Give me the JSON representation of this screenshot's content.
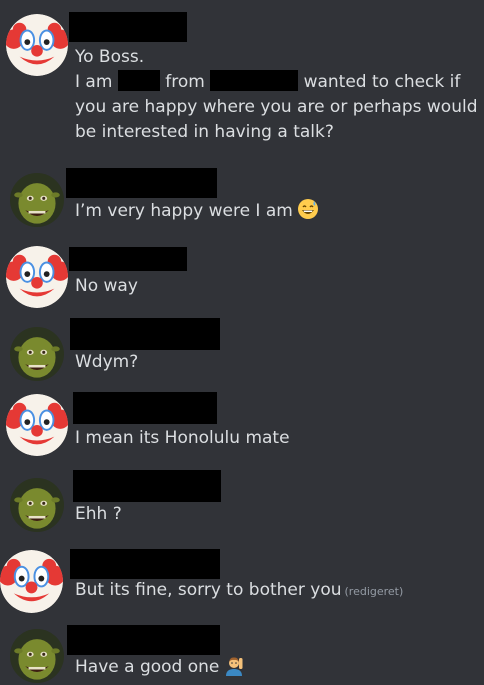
{
  "messages": [
    {
      "author_avatar": "clown-avatar",
      "lines": [
        "Yo Boss."
      ],
      "line2": {
        "pre": "I am ",
        "mid": " from ",
        "post": " wanted to check if"
      },
      "line3": "you are happy where you are or perhaps would",
      "line4": "be interested in having a talk?"
    },
    {
      "author_avatar": "shrek-avatar",
      "text": "I’m very happy were I am",
      "emoji": "sweat-smile-emoji"
    },
    {
      "author_avatar": "clown-avatar",
      "text": "No way"
    },
    {
      "author_avatar": "shrek-avatar",
      "text": "Wdym?"
    },
    {
      "author_avatar": "clown-avatar",
      "text": "I mean its Honolulu mate"
    },
    {
      "author_avatar": "shrek-avatar",
      "text": "Ehh ?"
    },
    {
      "author_avatar": "clown-avatar",
      "text": "But its fine, sorry to bother you",
      "edited": "(redigeret)"
    },
    {
      "author_avatar": "shrek-avatar",
      "text": "Have a good one",
      "emoji": "person-raising-hand-emoji"
    }
  ],
  "colors": {
    "background": "#313338",
    "text": "#dbdee1",
    "muted": "#949ba4",
    "redaction": "#000000"
  }
}
